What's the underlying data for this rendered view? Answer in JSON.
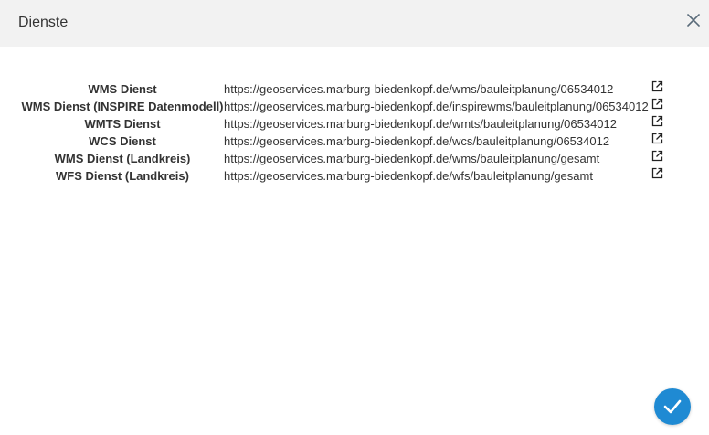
{
  "dialog": {
    "title": "Dienste"
  },
  "services": [
    {
      "label": "WMS Dienst",
      "url": "https://geoservices.marburg-biedenkopf.de/wms/bauleitplanung/06534012"
    },
    {
      "label": "WMS Dienst (INSPIRE Datenmodell)",
      "url": "https://geoservices.marburg-biedenkopf.de/inspirewms/bauleitplanung/06534012"
    },
    {
      "label": "WMTS Dienst",
      "url": "https://geoservices.marburg-biedenkopf.de/wmts/bauleitplanung/06534012"
    },
    {
      "label": "WCS Dienst",
      "url": "https://geoservices.marburg-biedenkopf.de/wcs/bauleitplanung/06534012"
    },
    {
      "label": "WMS Dienst (Landkreis)",
      "url": "https://geoservices.marburg-biedenkopf.de/wms/bauleitplanung/gesamt"
    },
    {
      "label": "WFS Dienst (Landkreis)",
      "url": "https://geoservices.marburg-biedenkopf.de/wfs/bauleitplanung/gesamt"
    }
  ],
  "icons": {
    "close": "close-icon",
    "external_link": "external-link-icon",
    "confirm": "checkmark-icon"
  },
  "colors": {
    "header_bg": "#f2f2f2",
    "text": "#333333",
    "accent": "#1f8ad3"
  }
}
